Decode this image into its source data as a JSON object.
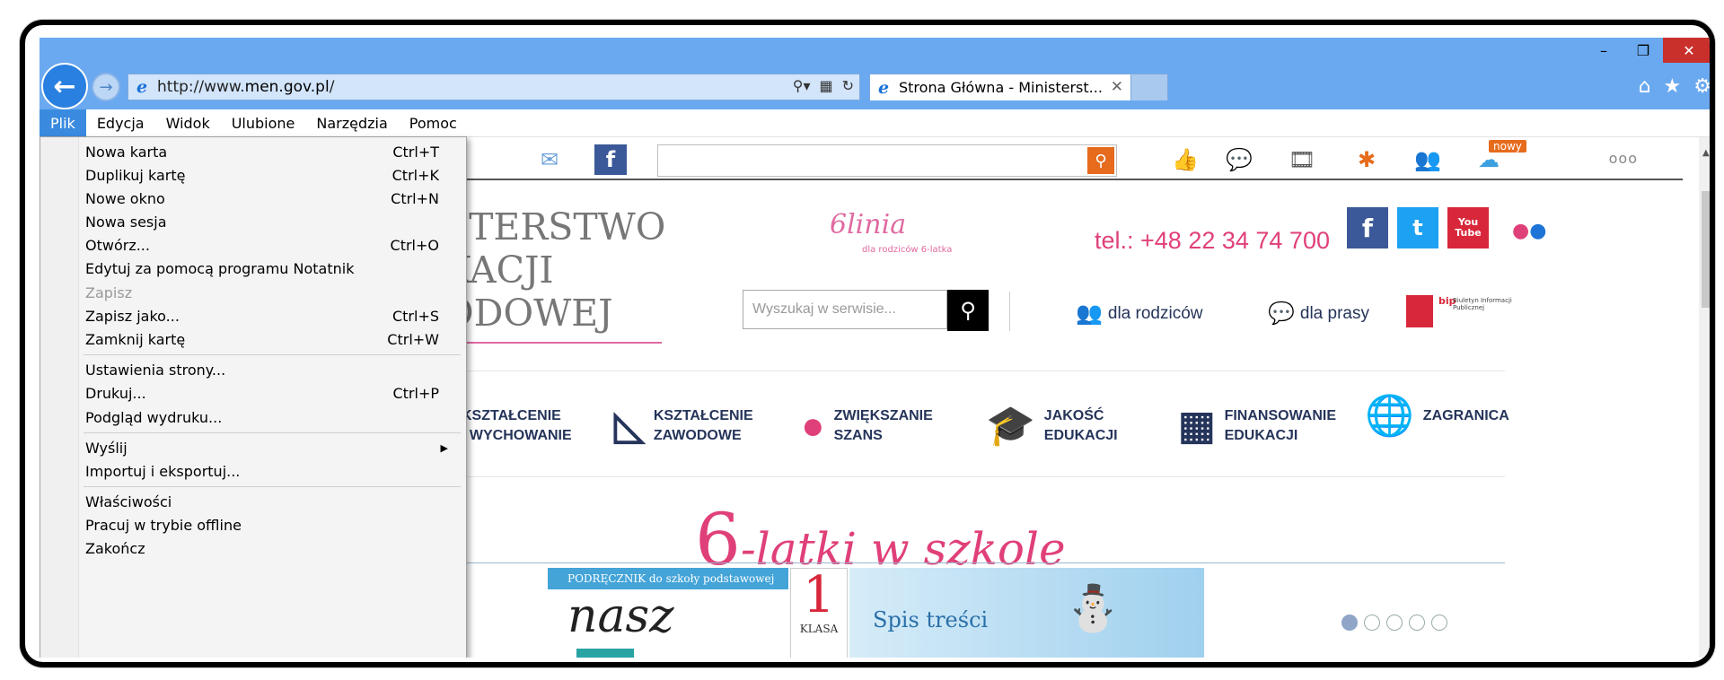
{
  "window": {
    "caption": {
      "minimize": "–",
      "restore": "❐",
      "close": "✕"
    }
  },
  "address": {
    "url_prefix": "http://www.",
    "url_domain": "men.gov.pl",
    "url_suffix": "/"
  },
  "tab": {
    "title": "Strona Główna - Ministerst...",
    "close": "✕"
  },
  "menubar": [
    "Plik",
    "Edycja",
    "Widok",
    "Ulubione",
    "Narzędzia",
    "Pomoc"
  ],
  "file_menu": [
    {
      "label": "Nowa karta",
      "shortcut": "Ctrl+T"
    },
    {
      "label": "Duplikuj kartę",
      "shortcut": "Ctrl+K"
    },
    {
      "label": "Nowe okno",
      "shortcut": "Ctrl+N"
    },
    {
      "label": "Nowa sesja",
      "shortcut": ""
    },
    {
      "label": "Otwórz...",
      "shortcut": "Ctrl+O"
    },
    {
      "label": "Edytuj za pomocą programu Notatnik",
      "shortcut": ""
    },
    {
      "label": "Zapisz",
      "shortcut": "",
      "disabled": true
    },
    {
      "label": "Zapisz jako...",
      "shortcut": "Ctrl+S"
    },
    {
      "label": "Zamknij kartę",
      "shortcut": "Ctrl+W"
    },
    {
      "label": "Ustawienia strony...",
      "shortcut": ""
    },
    {
      "label": "Drukuj...",
      "shortcut": "Ctrl+P"
    },
    {
      "label": "Podgląd wydruku...",
      "shortcut": ""
    },
    {
      "label": "Wyślij",
      "shortcut": "",
      "submenu": true
    },
    {
      "label": "Importuj i eksportuj...",
      "shortcut": ""
    },
    {
      "label": "Właściwości",
      "shortcut": ""
    },
    {
      "label": "Pracuj w trybie offline",
      "shortcut": ""
    },
    {
      "label": "Zakończ",
      "shortcut": ""
    }
  ],
  "favbar": {
    "nowy": "nowy",
    "more": "ooo"
  },
  "site": {
    "ministry_lines": [
      "STERSTWO",
      "KACJI",
      "ODOWEJ"
    ],
    "line6_sig": "6linia",
    "line6_sub": "dla rodziców 6-latka",
    "tel": "tel.: +48 22 34 74 700",
    "social": [
      "f",
      "t",
      "You Tube"
    ],
    "search_placeholder": "Wyszukaj w serwisie...",
    "quick_links": [
      "dla rodziców",
      "dla prasy"
    ],
    "bip": {
      "logo": "bip",
      "text": "Biuletyn Informacji Publicznej"
    },
    "categories": [
      {
        "line1": "KSZTAŁCENIE",
        "line2": "I WYCHOWANIE"
      },
      {
        "line1": "KSZTAŁCENIE",
        "line2": "ZAWODOWE"
      },
      {
        "line1": "ZWIĘKSZANIE",
        "line2": "SZANS"
      },
      {
        "line1": "JAKOŚĆ",
        "line2": "EDUKACJI"
      },
      {
        "line1": "FINANSOWANIE",
        "line2": "EDUKACJI"
      },
      {
        "line1": "ZAGRANICA",
        "line2": ""
      }
    ],
    "banner": {
      "six": "6",
      "text": "-latki w szkole"
    },
    "book": {
      "header": "PODRĘCZNIK do szkoły podstawowej",
      "title": "nasz"
    },
    "klasa": {
      "number": "1",
      "label": "KLASA"
    },
    "spis": "Spis treści"
  }
}
